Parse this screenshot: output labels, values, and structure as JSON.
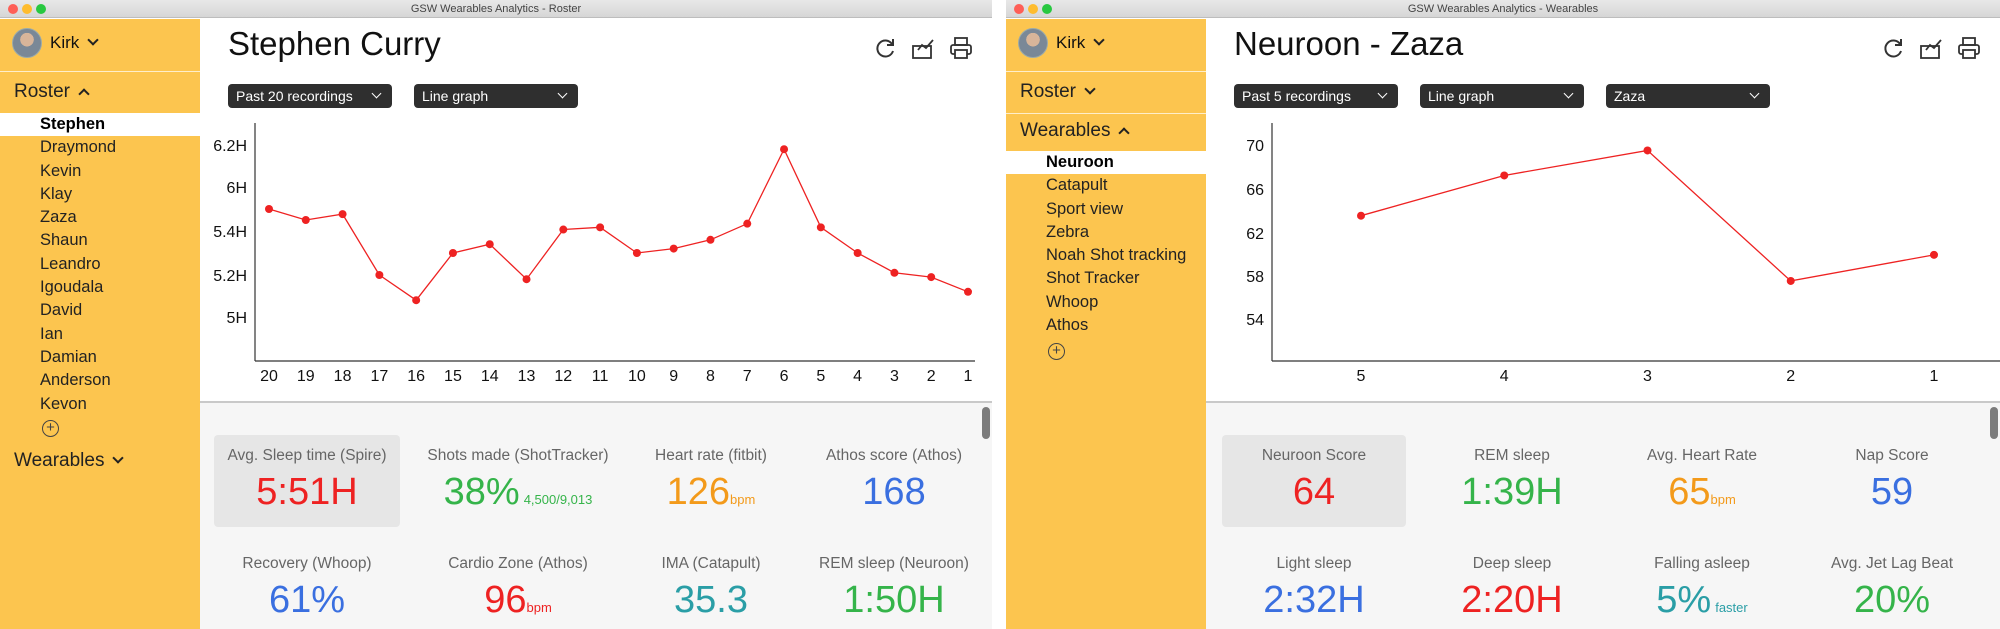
{
  "left": {
    "window_title": "GSW Wearables Analytics - Roster",
    "user": "Kirk",
    "roster_label": "Roster",
    "roster": [
      "Stephen",
      "Draymond",
      "Kevin",
      "Klay",
      "Zaza",
      "Shaun",
      "Leandro",
      "Igoudala",
      "David",
      "Ian",
      "Damian",
      "Anderson",
      "Kevon"
    ],
    "active_index": 0,
    "wearables_label": "Wearables",
    "page_title": "Stephen Curry",
    "select_range": "Past 20 recordings",
    "select_chart": "Line graph",
    "chart_data": {
      "type": "line",
      "categories": [
        "20",
        "19",
        "18",
        "17",
        "16",
        "15",
        "14",
        "13",
        "12",
        "11",
        "10",
        "9",
        "8",
        "7",
        "6",
        "5",
        "4",
        "3",
        "2",
        "1"
      ],
      "values": [
        5.7,
        5.55,
        5.63,
        5.2,
        5.08,
        5.3,
        5.34,
        5.18,
        5.42,
        5.45,
        5.3,
        5.32,
        5.36,
        5.5,
        6.18,
        5.45,
        5.3,
        5.21,
        5.19,
        5.12
      ],
      "ytick_labels": [
        "6.2H",
        "6H",
        "5.4H",
        "5.2H",
        "5H"
      ],
      "ylim": [
        5,
        6.2
      ],
      "xlabel": "",
      "ylabel": "",
      "line_color": "#ee2222"
    },
    "stats": [
      {
        "label": "Avg. Sleep time (Spire)",
        "value": "5:51H",
        "unit": "",
        "sub": "",
        "color": "red",
        "boxed": true
      },
      {
        "label": "Shots made (ShotTracker)",
        "value": "38%",
        "unit": "",
        "sub": "4,500/9,013",
        "color": "green",
        "boxed": false
      },
      {
        "label": "Heart rate (fitbit)",
        "value": "126",
        "unit": "bpm",
        "sub": "",
        "color": "orange",
        "boxed": false
      },
      {
        "label": "Athos score (Athos)",
        "value": "168",
        "unit": "",
        "sub": "",
        "color": "blue",
        "boxed": false
      },
      {
        "label": "Recovery (Whoop)",
        "value": "61%",
        "unit": "",
        "sub": "",
        "color": "blue",
        "boxed": false
      },
      {
        "label": "Cardio Zone (Athos)",
        "value": "96",
        "unit": "bpm",
        "sub": "",
        "color": "red",
        "boxed": false
      },
      {
        "label": "IMA (Catapult)",
        "value": "35.3",
        "unit": "",
        "sub": "",
        "color": "teal",
        "boxed": false
      },
      {
        "label": "REM sleep (Neuroon)",
        "value": "1:50H",
        "unit": "",
        "sub": "",
        "color": "green",
        "boxed": false
      }
    ]
  },
  "right": {
    "window_title": "GSW Wearables Analytics - Wearables",
    "user": "Kirk",
    "roster_label": "Roster",
    "wearables_label": "Wearables",
    "wearables": [
      "Neuroon",
      "Catapult",
      "Sport view",
      "Zebra",
      "Noah Shot tracking",
      "Shot Tracker",
      "Whoop",
      "Athos"
    ],
    "active_index": 0,
    "page_title": "Neuroon - Zaza",
    "select_range": "Past 5 recordings",
    "select_chart": "Line graph",
    "select_player": "Zaza",
    "chart_data": {
      "type": "line",
      "categories": [
        "5",
        "4",
        "3",
        "2",
        "1"
      ],
      "values": [
        63.5,
        67.2,
        69.5,
        57.5,
        59.9
      ],
      "ytick_labels": [
        "70",
        "66",
        "62",
        "58",
        "54"
      ],
      "ylim": [
        54,
        70
      ],
      "xlabel": "",
      "ylabel": "",
      "line_color": "#ee2222"
    },
    "stats": [
      {
        "label": "Neuroon Score",
        "value": "64",
        "unit": "",
        "sub": "",
        "color": "red",
        "boxed": true
      },
      {
        "label": "REM sleep",
        "value": "1:39H",
        "unit": "",
        "sub": "",
        "color": "green",
        "boxed": false
      },
      {
        "label": "Avg. Heart Rate",
        "value": "65",
        "unit": "bpm",
        "sub": "",
        "color": "orange",
        "boxed": false
      },
      {
        "label": "Nap Score",
        "value": "59",
        "unit": "",
        "sub": "",
        "color": "blue",
        "boxed": false
      },
      {
        "label": "Light sleep",
        "value": "2:32H",
        "unit": "",
        "sub": "",
        "color": "blue",
        "boxed": false
      },
      {
        "label": "Deep sleep",
        "value": "2:20H",
        "unit": "",
        "sub": "",
        "color": "red",
        "boxed": false
      },
      {
        "label": "Falling asleep",
        "value": "5%",
        "unit": "",
        "sub": "faster",
        "color": "teal",
        "boxed": false
      },
      {
        "label": "Avg. Jet Lag Beat",
        "value": "20%",
        "unit": "",
        "sub": "",
        "color": "green",
        "boxed": false
      }
    ]
  },
  "colors": {
    "sidebar": "#fcc54f",
    "accent_red": "#ee2222"
  }
}
